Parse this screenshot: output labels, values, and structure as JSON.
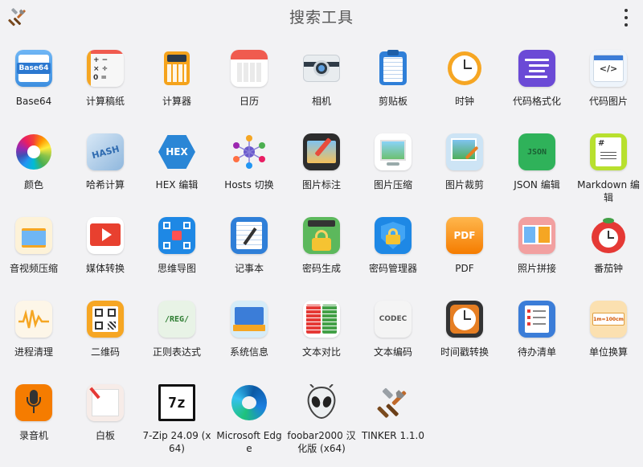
{
  "header": {
    "title": "搜索工具",
    "app_icon": "tools-icon",
    "menu_icon": "more-vertical-icon"
  },
  "icon_texts": {
    "base64": "Base64",
    "hash": "HASH",
    "hex": "HEX",
    "json": "JSON",
    "pdf": "PDF",
    "regex": "/REG/",
    "codec": "CODEC",
    "sevenzip": "7z",
    "unit": "1m=100cm"
  },
  "tools": [
    {
      "label": "Base64",
      "icon": "base64-icon"
    },
    {
      "label": "计算稿纸",
      "icon": "calculator-paper-icon"
    },
    {
      "label": "计算器",
      "icon": "calculator-icon"
    },
    {
      "label": "日历",
      "icon": "calendar-icon"
    },
    {
      "label": "相机",
      "icon": "camera-icon"
    },
    {
      "label": "剪贴板",
      "icon": "clipboard-icon"
    },
    {
      "label": "时钟",
      "icon": "clock-icon"
    },
    {
      "label": "代码格式化",
      "icon": "code-format-icon"
    },
    {
      "label": "代码图片",
      "icon": "code-image-icon"
    },
    {
      "label": "颜色",
      "icon": "color-wheel-icon"
    },
    {
      "label": "哈希计算",
      "icon": "hash-icon"
    },
    {
      "label": "HEX 编辑",
      "icon": "hex-icon"
    },
    {
      "label": "Hosts 切换",
      "icon": "hosts-network-icon"
    },
    {
      "label": "图片标注",
      "icon": "image-annotate-icon"
    },
    {
      "label": "图片压缩",
      "icon": "image-compress-icon"
    },
    {
      "label": "图片裁剪",
      "icon": "image-crop-icon"
    },
    {
      "label": "JSON 编辑",
      "icon": "json-icon"
    },
    {
      "label": "Markdown 编辑",
      "icon": "markdown-icon"
    },
    {
      "label": "音视频压缩",
      "icon": "media-compress-icon"
    },
    {
      "label": "媒体转换",
      "icon": "media-convert-icon"
    },
    {
      "label": "思维导图",
      "icon": "mindmap-icon"
    },
    {
      "label": "记事本",
      "icon": "notepad-icon"
    },
    {
      "label": "密码生成",
      "icon": "password-generate-icon"
    },
    {
      "label": "密码管理器",
      "icon": "password-manager-icon"
    },
    {
      "label": "PDF",
      "icon": "pdf-icon"
    },
    {
      "label": "照片拼接",
      "icon": "photo-stitch-icon"
    },
    {
      "label": "番茄钟",
      "icon": "tomato-timer-icon"
    },
    {
      "label": "进程清理",
      "icon": "process-clean-icon"
    },
    {
      "label": "二维码",
      "icon": "qrcode-icon"
    },
    {
      "label": "正则表达式",
      "icon": "regex-icon"
    },
    {
      "label": "系统信息",
      "icon": "system-info-icon"
    },
    {
      "label": "文本对比",
      "icon": "text-compare-icon"
    },
    {
      "label": "文本编码",
      "icon": "text-encoding-icon"
    },
    {
      "label": "时间戳转换",
      "icon": "timestamp-icon"
    },
    {
      "label": "待办清单",
      "icon": "todo-list-icon"
    },
    {
      "label": "单位换算",
      "icon": "unit-convert-icon"
    },
    {
      "label": "录音机",
      "icon": "microphone-icon"
    },
    {
      "label": "白板",
      "icon": "whiteboard-icon"
    },
    {
      "label": "7-Zip 24.09 (x64)",
      "icon": "7zip-icon"
    },
    {
      "label": "Microsoft Edge",
      "icon": "edge-icon"
    },
    {
      "label": "foobar2000 汉化版 (x64)",
      "icon": "foobar-icon"
    },
    {
      "label": "TINKER 1.1.0",
      "icon": "tinker-tools-icon"
    }
  ],
  "colors": {
    "background": "#f2f2f4",
    "text": "#222222",
    "title": "#555555"
  }
}
